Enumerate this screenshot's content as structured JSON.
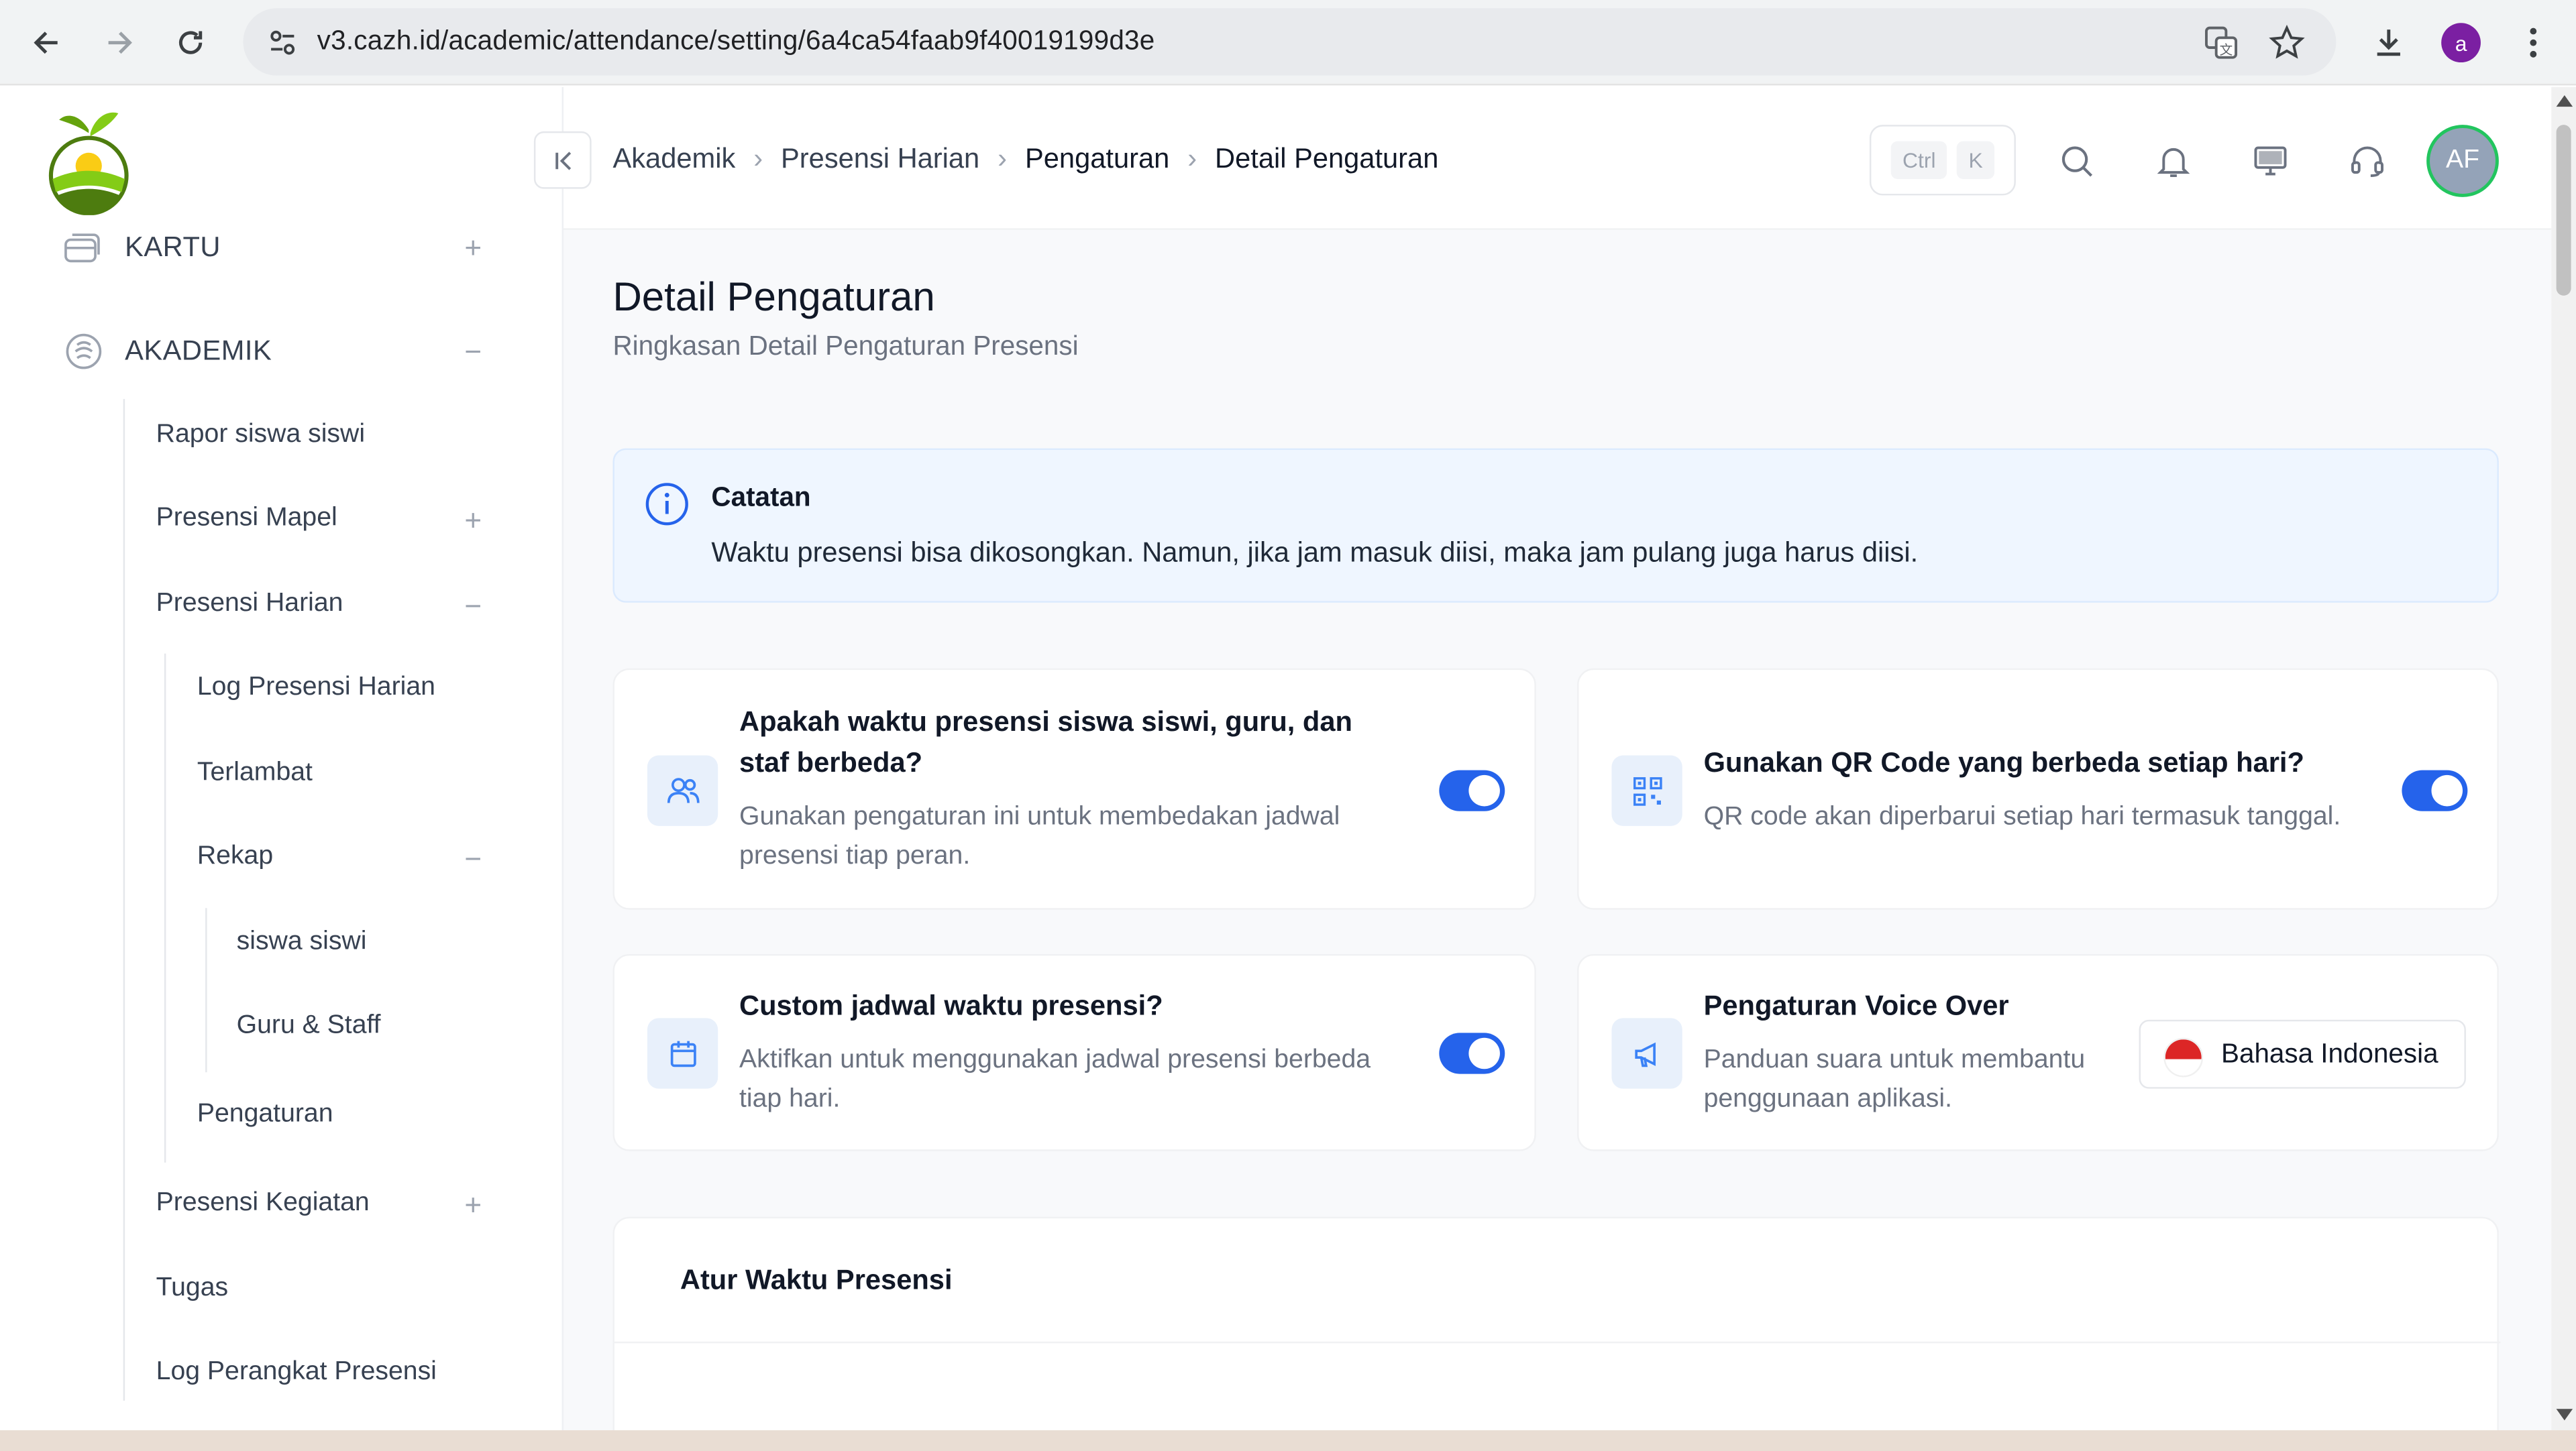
{
  "browser": {
    "url": "v3.cazh.id/academic/attendance/setting/6a4ca54faab9f40019199d3e",
    "profile_initial": "a"
  },
  "sidebar": {
    "sections": [
      {
        "label": "KARTU",
        "state": "collapsed"
      },
      {
        "label": "AKADEMIK",
        "state": "expanded"
      }
    ],
    "items": {
      "rapor": "Rapor siswa siswi",
      "presensi_mapel": "Presensi Mapel",
      "presensi_harian": "Presensi Harian",
      "log_presensi_harian": "Log Presensi Harian",
      "terlambat": "Terlambat",
      "rekap": "Rekap",
      "rekap_siswa": "siswa siswi",
      "rekap_guru": "Guru & Staff",
      "pengaturan": "Pengaturan",
      "presensi_kegiatan": "Presensi Kegiatan",
      "tugas": "Tugas",
      "log_perangkat": "Log Perangkat Presensi"
    }
  },
  "breadcrumb": [
    "Akademik",
    "Presensi Harian",
    "Pengaturan",
    "Detail Pengaturan"
  ],
  "shortcut": {
    "key1": "Ctrl",
    "key2": "K"
  },
  "user_avatar": "AF",
  "page": {
    "title": "Detail Pengaturan",
    "subtitle": "Ringkasan Detail Pengaturan Presensi"
  },
  "note": {
    "title": "Catatan",
    "text": "Waktu presensi bisa dikosongkan. Namun, jika jam masuk diisi, maka jam pulang juga harus diisi."
  },
  "settings": [
    {
      "title_line1": "Apakah waktu presensi siswa siswi, guru, dan",
      "title_line2": "staf berbeda?",
      "desc_line1": "Gunakan pengaturan ini untuk membedakan jadwal",
      "desc_line2": "presensi tiap peran.",
      "enabled": true
    },
    {
      "title": "Gunakan QR Code yang berbeda setiap hari?",
      "desc": "QR code akan diperbarui setiap hari termasuk tanggal.",
      "enabled": true
    },
    {
      "title": "Custom jadwal waktu presensi?",
      "desc_line1": "Aktifkan untuk menggunakan jadwal presensi berbeda",
      "desc_line2": "tiap hari.",
      "enabled": true
    },
    {
      "title": "Pengaturan Voice Over",
      "desc_line1": "Panduan suara untuk membantu",
      "desc_line2": "penggunaan aplikasi.",
      "language": "Bahasa Indonesia"
    }
  ],
  "time_section": {
    "title": "Atur Waktu Presensi"
  },
  "colors": {
    "accent": "#2563eb",
    "note_bg": "#eff6ff",
    "avatar_ring": "#22c55e"
  }
}
